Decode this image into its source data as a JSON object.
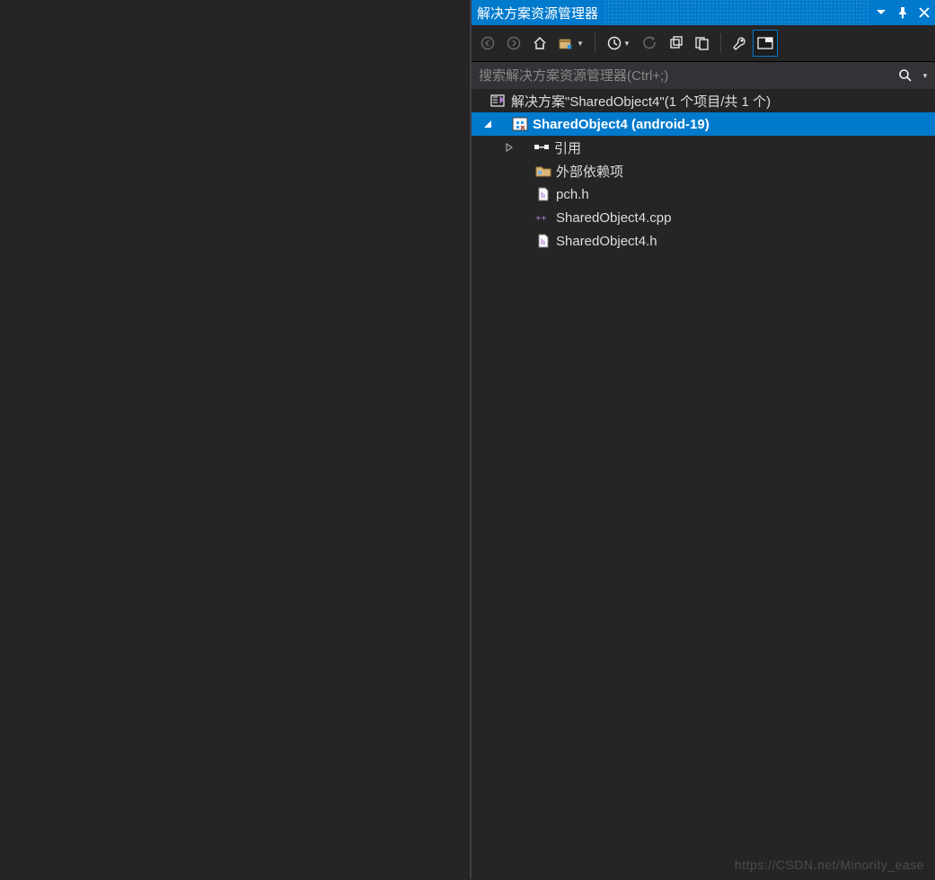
{
  "panel": {
    "title": "解决方案资源管理器"
  },
  "search": {
    "placeholder": "搜索解决方案资源管理器(Ctrl+;)"
  },
  "tree": {
    "solution": {
      "label": "解决方案\"SharedObject4\"(1 个项目/共 1 个)"
    },
    "project": {
      "label": "SharedObject4 (android-19)"
    },
    "references": {
      "label": "引用"
    },
    "external_deps": {
      "label": "外部依赖项"
    },
    "pch_h": {
      "label": "pch.h"
    },
    "so4_cpp": {
      "label": "SharedObject4.cpp"
    },
    "so4_h": {
      "label": "SharedObject4.h"
    }
  },
  "watermark": "https://CSDN.net/Minority_ease"
}
